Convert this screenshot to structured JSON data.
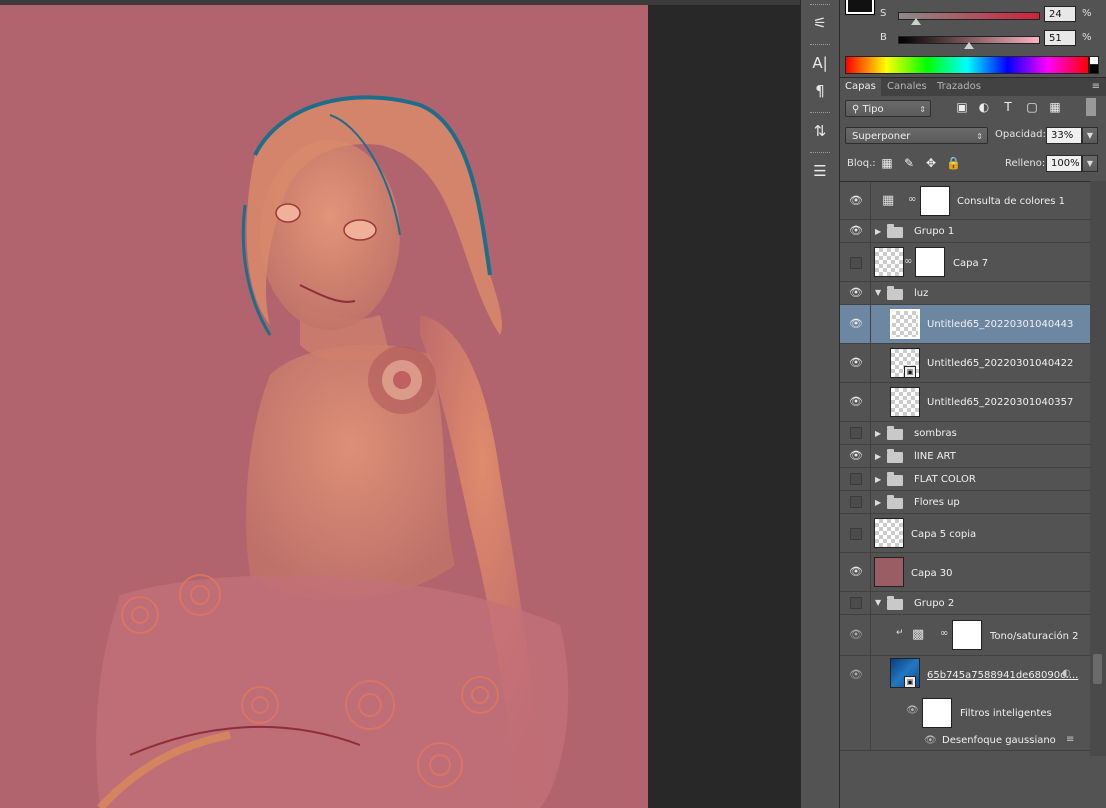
{
  "color_panel": {
    "s_label": "S",
    "s_value": "24",
    "s_level": 0.24,
    "b_label": "B",
    "b_value": "51",
    "b_level": 0.51,
    "percent": "%"
  },
  "tabs": [
    {
      "label": "Capas"
    },
    {
      "label": "Canales"
    },
    {
      "label": "Trazados"
    }
  ],
  "filter": {
    "kind": "Tipo"
  },
  "blend": {
    "mode": "Superponer",
    "opacity_label": "Opacidad:",
    "opacity_value": "33%",
    "lock_label": "Bloq.:",
    "fill_label": "Relleno:",
    "fill_value": "100%"
  },
  "layers": [
    {
      "name": "Consulta de colores 1"
    },
    {
      "name": "Grupo 1"
    },
    {
      "name": "Capa 7"
    },
    {
      "name": "luz"
    },
    {
      "name": "Untitled65_20220301040443"
    },
    {
      "name": "Untitled65_20220301040422"
    },
    {
      "name": "Untitled65_20220301040357"
    },
    {
      "name": "sombras"
    },
    {
      "name": "lINE ART"
    },
    {
      "name": "FLAT COLOR"
    },
    {
      "name": "Flores up"
    },
    {
      "name": "Capa 5 copia"
    },
    {
      "name": "Capa 30"
    },
    {
      "name": "Grupo 2"
    },
    {
      "name": "Tono/saturación 2"
    },
    {
      "name": "65b745a7588941de68090c...."
    },
    {
      "name": "Filtros inteligentes"
    },
    {
      "name": "Desenfoque gaussiano"
    }
  ],
  "colors": {
    "canvas_bg": "#b1646d",
    "panel_bg": "#535353",
    "selected_row": "#6d87a3"
  }
}
